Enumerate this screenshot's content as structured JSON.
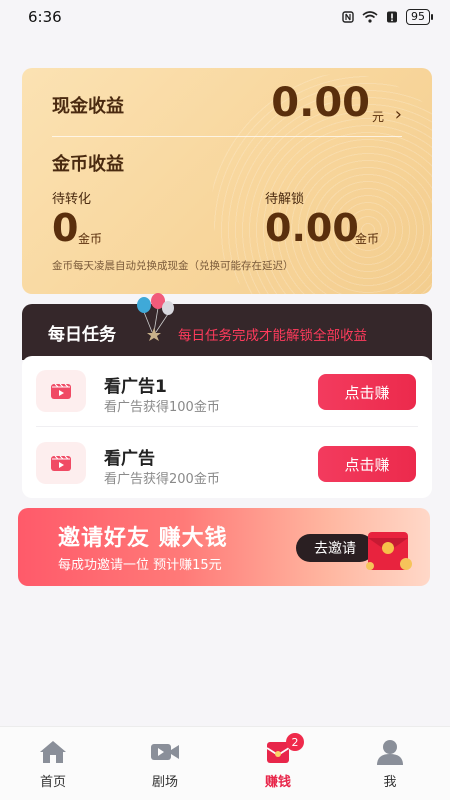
{
  "status_bar": {
    "time": "6:36",
    "battery": "95"
  },
  "earnings": {
    "cash_label": "现金收益",
    "cash_value": "0.00",
    "cash_unit": "元",
    "coin_label": "金币收益",
    "pending_label": "待转化",
    "pending_value": "0",
    "pending_unit": "金币",
    "locked_label": "待解锁",
    "locked_value": "0.00",
    "locked_unit": "金币",
    "note": "金币每天凌晨自动兑换成现金（兑换可能存在延迟）"
  },
  "daily": {
    "title": "每日任务",
    "note": "每日任务完成才能解锁全部收益"
  },
  "tasks": [
    {
      "title": "看广告1",
      "subtitle": "看广告获得100金币",
      "button": "点击赚"
    },
    {
      "title": "看广告",
      "subtitle": "看广告获得200金币",
      "button": "点击赚"
    }
  ],
  "invite": {
    "title": "邀请好友 赚大钱",
    "subtitle": "每成功邀请一位 预计赚15元",
    "button": "去邀请"
  },
  "nav": {
    "items": [
      {
        "label": "首页",
        "icon": "home-icon"
      },
      {
        "label": "剧场",
        "icon": "video-camera-icon"
      },
      {
        "label": "赚钱",
        "icon": "red-envelope-icon",
        "badge": "2",
        "active": true
      },
      {
        "label": "我",
        "icon": "user-icon"
      }
    ]
  },
  "colors": {
    "accent": "#ec2a4c",
    "card_gold": "#f8d69c",
    "dark_header": "#35272a"
  }
}
